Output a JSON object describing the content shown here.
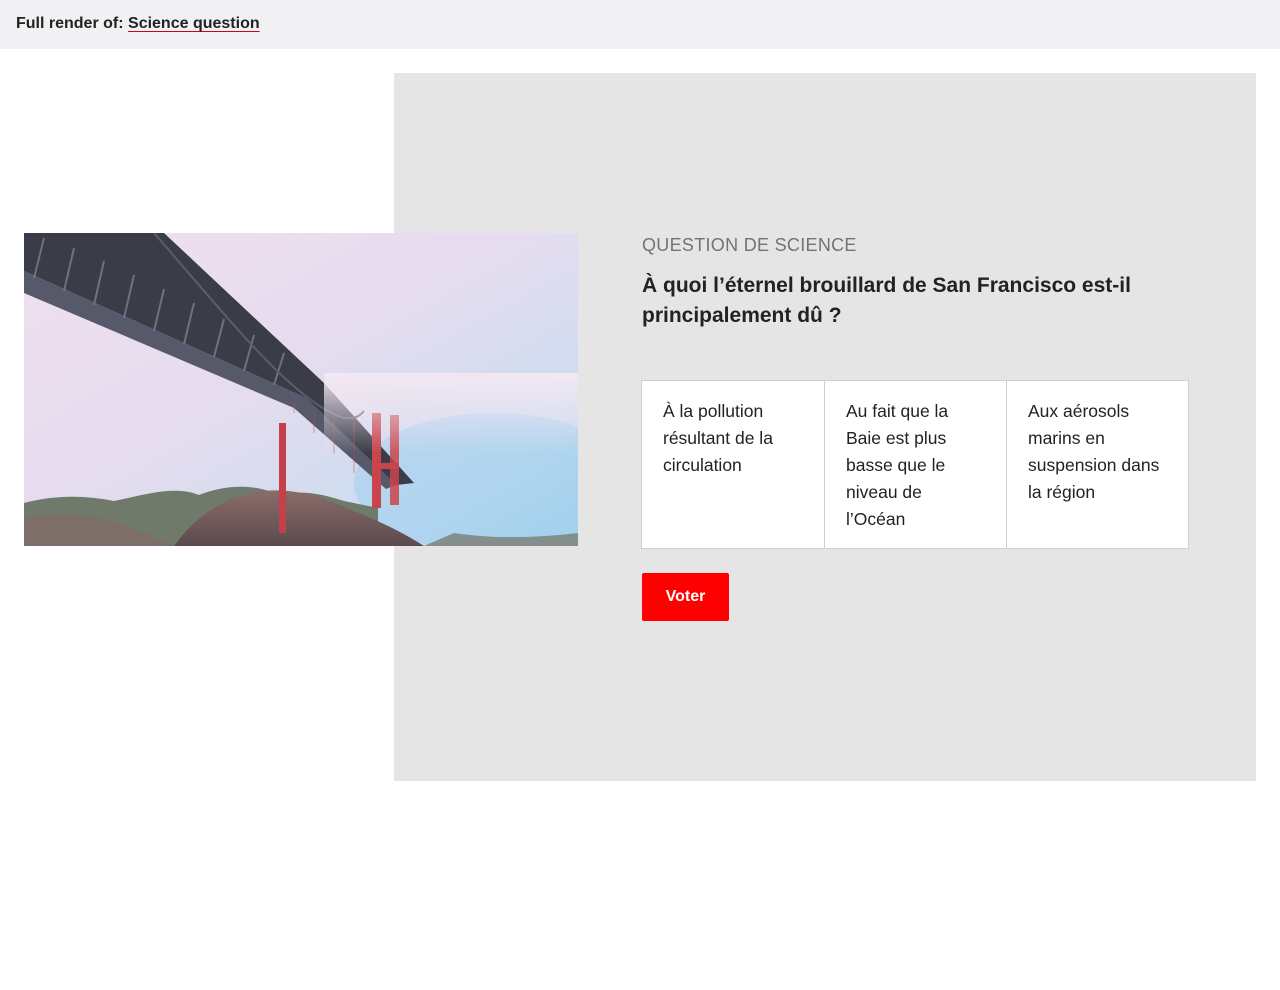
{
  "topbar": {
    "prefix": "Full render of:",
    "link": "Science question"
  },
  "poll": {
    "kicker": "QUESTION DE SCIENCE",
    "question": "À quoi l’éternel brouillard de San Francisco est-il principalement dû ?",
    "options": [
      "À la pollution résultant de la circulation",
      "Au fait que la Baie est plus basse que le niveau de l’Océan",
      "Aux aérosols marins en suspension dans la région"
    ],
    "vote_label": "Voter"
  },
  "colors": {
    "accent": "#ff0000",
    "panel_background": "#e5e5e5",
    "topbar_background": "#f1f1f3"
  },
  "image": {
    "subject": "golden-gate-bridge-in-fog"
  }
}
